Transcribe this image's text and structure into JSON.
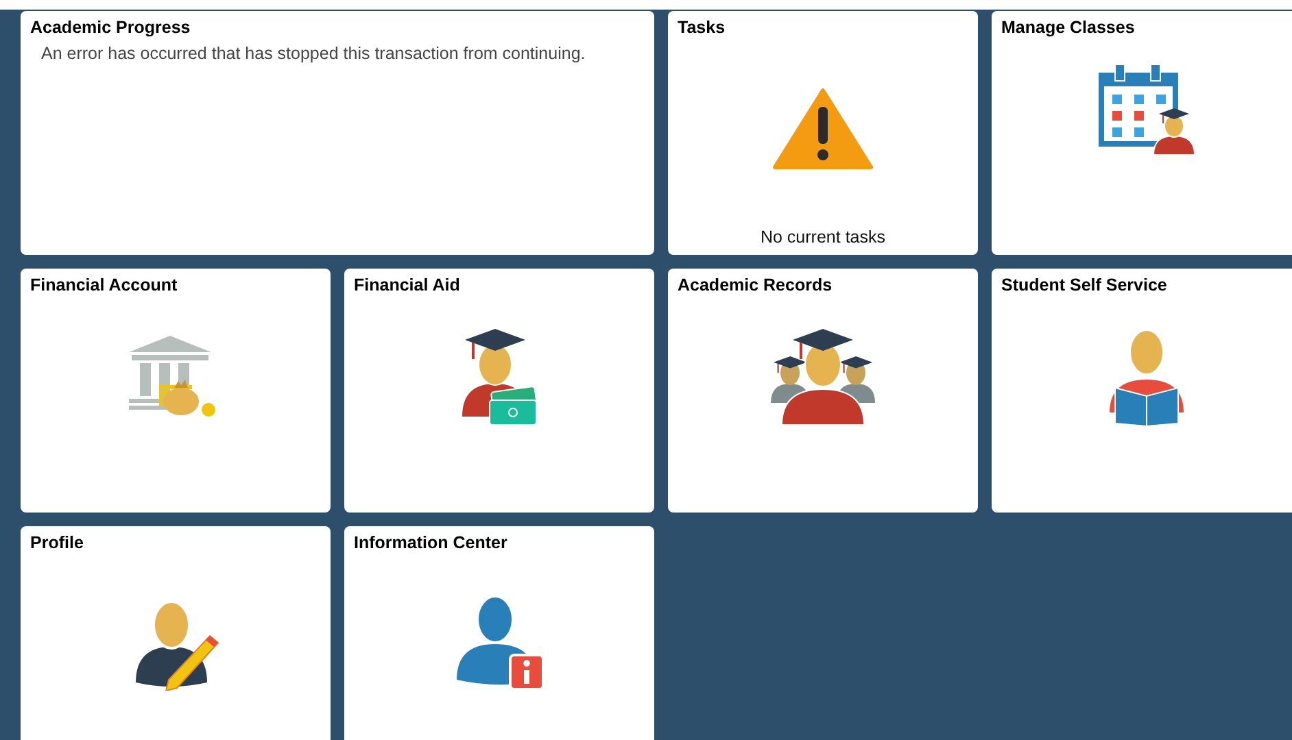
{
  "tiles": [
    {
      "title": "Academic Progress",
      "message": "An error has occurred that has stopped this transaction from continuing."
    },
    {
      "title": "Tasks",
      "status": "No current tasks"
    },
    {
      "title": "Manage Classes"
    },
    {
      "title": "Financial Account"
    },
    {
      "title": "Financial Aid"
    },
    {
      "title": "Academic Records"
    },
    {
      "title": "Student Self Service"
    },
    {
      "title": "Profile"
    },
    {
      "title": "Information Center"
    }
  ]
}
